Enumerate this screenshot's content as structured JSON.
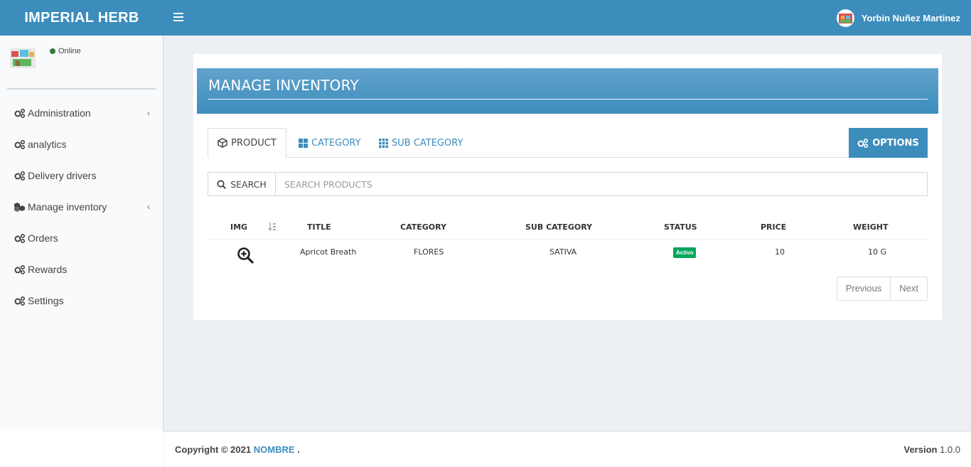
{
  "header": {
    "brand": "IMPERIAL HERB",
    "user_name": "Yorbin Nuñez Martinez"
  },
  "sidebar": {
    "status": "Online",
    "items": [
      {
        "label": "Administration",
        "icon": "gears-icon",
        "has_children": true
      },
      {
        "label": "analytics",
        "icon": "gears-icon",
        "has_children": false
      },
      {
        "label": "Delivery drivers",
        "icon": "gears-icon",
        "has_children": false
      },
      {
        "label": "Manage inventory",
        "icon": "cubes-icon",
        "has_children": true
      },
      {
        "label": "Orders",
        "icon": "gears-icon",
        "has_children": false
      },
      {
        "label": "Rewards",
        "icon": "gears-icon",
        "has_children": false
      },
      {
        "label": "Settings",
        "icon": "gears-icon",
        "has_children": false
      }
    ]
  },
  "main": {
    "title": "MANAGE INVENTORY",
    "tabs": [
      {
        "label": "PRODUCT",
        "icon": "cube-icon",
        "active": true
      },
      {
        "label": "CATEGORY",
        "icon": "grid-large-icon",
        "active": false
      },
      {
        "label": "SUB CATEGORY",
        "icon": "grid-small-icon",
        "active": false
      }
    ],
    "options_label": "OPTIONS",
    "search": {
      "label": "SEARCH",
      "placeholder": "SEARCH PRODUCTS"
    },
    "table": {
      "columns": [
        "IMG",
        "TITLE",
        "CATEGORY",
        "SUB CATEGORY",
        "STATUS",
        "PRICE",
        "WEIGHT"
      ],
      "rows": [
        {
          "title": "Apricot Breath",
          "category": "FLORES",
          "sub_category": "SATIVA",
          "status": "Activo",
          "price": "10",
          "weight": "10 G"
        }
      ]
    },
    "pagination": {
      "previous": "Previous",
      "next": "Next"
    }
  },
  "footer": {
    "copyright_prefix": "Copyright © 2021",
    "company": "NOMBRE",
    "suffix": ".",
    "version_label": "Version",
    "version": "1.0.0"
  },
  "colors": {
    "primary": "#3c8dbc",
    "success": "#00a65a",
    "online": "#3c763d"
  }
}
